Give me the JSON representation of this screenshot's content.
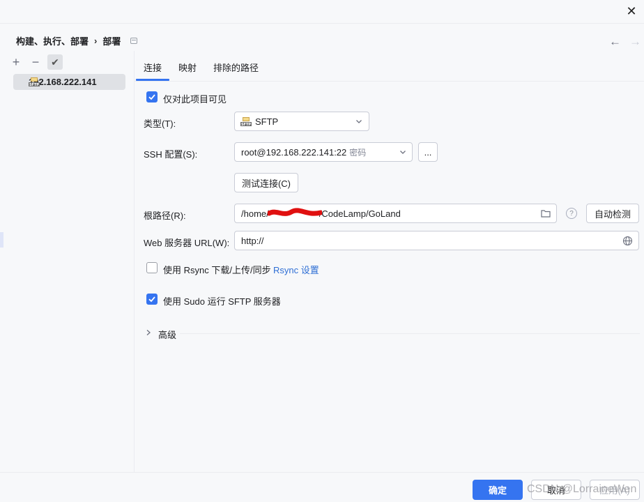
{
  "window": {
    "close_icon": "close-icon"
  },
  "breadcrumb": {
    "parent": "构建、执行、部署",
    "separator": "›",
    "current": "部署"
  },
  "left_panel": {
    "toolbar": {
      "add": "+",
      "remove": "−",
      "check": "✔"
    },
    "servers": [
      {
        "name": "192.168.222.141",
        "icon": "sftp-icon"
      }
    ]
  },
  "tabs": [
    {
      "label": "连接",
      "active": true
    },
    {
      "label": "映射",
      "active": false
    },
    {
      "label": "排除的路径",
      "active": false
    }
  ],
  "form": {
    "visible_only_this_project": {
      "label": "仅对此项目可见",
      "checked": true
    },
    "type": {
      "label": "类型(T):",
      "value": "SFTP",
      "icon": "sftp-icon"
    },
    "ssh_config": {
      "label": "SSH 配置(S):",
      "value": "root@192.168.222.141:22",
      "hint": "密码",
      "more_button": "..."
    },
    "test_connection": {
      "label": "测试连接(C)"
    },
    "root_path": {
      "label": "根路径(R):",
      "value_prefix": "/home/",
      "value_suffix": "/CodeLamp/GoLand",
      "auto_detect": "自动检测",
      "help": "?"
    },
    "web_url": {
      "label": "Web 服务器 URL(W):",
      "value": "http://"
    },
    "rsync": {
      "label": "使用 Rsync 下载/上传/同步",
      "link": "Rsync 设置",
      "checked": false
    },
    "sudo": {
      "label": "使用 Sudo 运行 SFTP 服务器",
      "checked": true
    },
    "advanced": {
      "label": "高级"
    }
  },
  "footer": {
    "ok": "确定",
    "cancel": "取消",
    "apply": "应用(A)"
  },
  "watermark": "CSDN @LorraineWen",
  "colors": {
    "accent": "#3574f0",
    "background": "#f7f8fa",
    "redaction": "#e01010"
  }
}
